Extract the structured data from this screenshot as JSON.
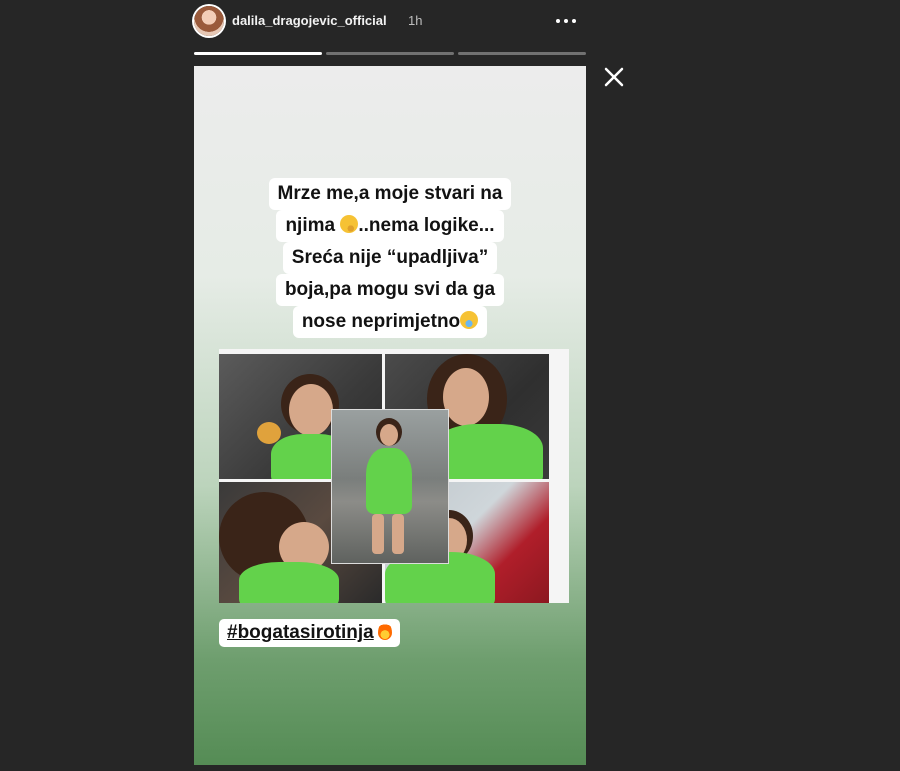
{
  "header": {
    "username": "dalila_dragojevic_official",
    "timestamp": "1h"
  },
  "progress": {
    "segments": 3,
    "active_index": 0
  },
  "story": {
    "caption_lines": [
      "Mrze me,a moje stvari na",
      "njima",
      "..nema logike...",
      "Sreća nije “upadljiva”",
      "boja,pa mogu svi da ga",
      "nose neprimjetno"
    ],
    "hashtag": "#bogatasirotinja"
  },
  "icons": {
    "more": "more-options-icon",
    "close": "close-icon",
    "emoji_think": "thinking-face-emoji",
    "emoji_laugh": "tears-of-joy-emoji",
    "emoji_fire": "fire-emoji"
  },
  "colors": {
    "background": "#262626",
    "sweater_green": "#63d24b"
  }
}
